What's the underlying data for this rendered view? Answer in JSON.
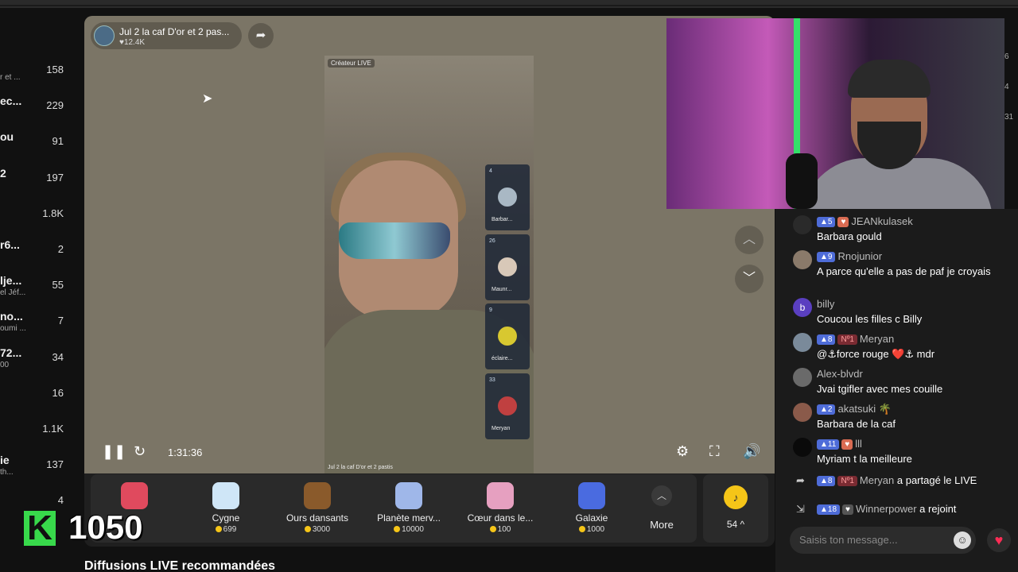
{
  "left_list": [
    {
      "name": "",
      "sub": "r et ...",
      "count": "158"
    },
    {
      "name": "ec...",
      "sub": "",
      "count": "229"
    },
    {
      "name": "ou",
      "sub": "",
      "count": "91"
    },
    {
      "name": "2",
      "sub": "",
      "count": "197"
    },
    {
      "name": "",
      "sub": "",
      "count": "1.8K"
    },
    {
      "name": "r6...",
      "sub": "",
      "count": "2"
    },
    {
      "name": "lje...",
      "sub": "el Jéf...",
      "count": "55"
    },
    {
      "name": "no...",
      "sub": "oumi ...",
      "count": "7"
    },
    {
      "name": "72...",
      "sub": "00",
      "count": "34"
    },
    {
      "name": "",
      "sub": "",
      "count": "16"
    },
    {
      "name": "",
      "sub": "",
      "count": "1.1K"
    },
    {
      "name": "ie",
      "sub": "th...",
      "count": "137"
    },
    {
      "name": "",
      "sub": "",
      "count": "4"
    }
  ],
  "live": {
    "title": "Jul 2 la caf D'or et 2 pas...",
    "likes": "♥12.4K",
    "creator_tag": "Créateur LIVE",
    "caption": "Jul 2 la caf D'or et 2 pastis",
    "time": "1:31:36"
  },
  "guests": [
    {
      "level": "4",
      "name": "Barbar..."
    },
    {
      "level": "26",
      "name": "Maunr..."
    },
    {
      "level": "9",
      "name": "éclaire..."
    },
    {
      "level": "33",
      "name": "Meryan"
    }
  ],
  "gifts": [
    {
      "name": "",
      "price": "",
      "icon": "rose-icon",
      "color": "#e04a5e"
    },
    {
      "name": "Cygne",
      "price": "699",
      "icon": "swan-icon",
      "color": "#cfe6f7"
    },
    {
      "name": "Ours dansants",
      "price": "3000",
      "icon": "bears-icon",
      "color": "#8a5a2b"
    },
    {
      "name": "Planète merv...",
      "price": "10000",
      "icon": "planet-icon",
      "color": "#9fb7e9"
    },
    {
      "name": "Cœur dans le...",
      "price": "100",
      "icon": "heart-hands-icon",
      "color": "#e6a0c0"
    },
    {
      "name": "Galaxie",
      "price": "1000",
      "icon": "galaxy-icon",
      "color": "#4a6be0"
    }
  ],
  "more_label": "More",
  "coin_balance": "54 ^",
  "overlay": {
    "k": "K",
    "number": "1050"
  },
  "recommended": "Diffusions LIVE recommandées",
  "chat": {
    "messages": [
      {
        "avatar": "",
        "level": "5",
        "fan": true,
        "top": "",
        "user": "JEANkulasek",
        "text": "Barbara gould",
        "avatar_color": "#2a2a2a"
      },
      {
        "avatar": "",
        "level": "9",
        "fan": false,
        "top": "",
        "user": "Rnojunior",
        "text": "A parce qu'elle a pas de paf je croyais",
        "avatar_color": "#8a7a6a"
      },
      {
        "avatar": "b",
        "level": "",
        "fan": false,
        "top": "",
        "user": "billy",
        "text": "Coucou les filles c Billy",
        "avatar_color": "#5a3fc0"
      },
      {
        "avatar": "",
        "level": "8",
        "fan": false,
        "top": "Nº1",
        "user": "Meryan",
        "text": "@⚓force rouge ❤️⚓ mdr",
        "avatar_color": "#7a8a9a"
      },
      {
        "avatar": "",
        "level": "",
        "fan": false,
        "top": "",
        "user": "Alex-blvdr",
        "text": "Jvai tgifler avec mes couille",
        "avatar_color": "#6a6a6a"
      },
      {
        "avatar": "",
        "level": "2",
        "fan": false,
        "top": "",
        "user": "akatsuki 🌴",
        "text": "Barbara de la caf",
        "avatar_color": "#8a5a4a"
      },
      {
        "avatar": "",
        "level": "11",
        "fan": true,
        "top": "",
        "user": "lll",
        "text": "Myriam t la meilleure",
        "avatar_color": "#0a0a0a"
      }
    ],
    "events": [
      {
        "icon": "share-icon",
        "level": "8",
        "top": "Nº1",
        "user": "Meryan",
        "action": "a partagé le LIVE"
      },
      {
        "icon": "join-icon",
        "level": "18",
        "top": "",
        "user": "Winnerpower",
        "action": "a rejoint"
      }
    ],
    "input_placeholder": "Saisis ton message..."
  },
  "right_edge_numbers": [
    "6",
    "4",
    "31"
  ]
}
